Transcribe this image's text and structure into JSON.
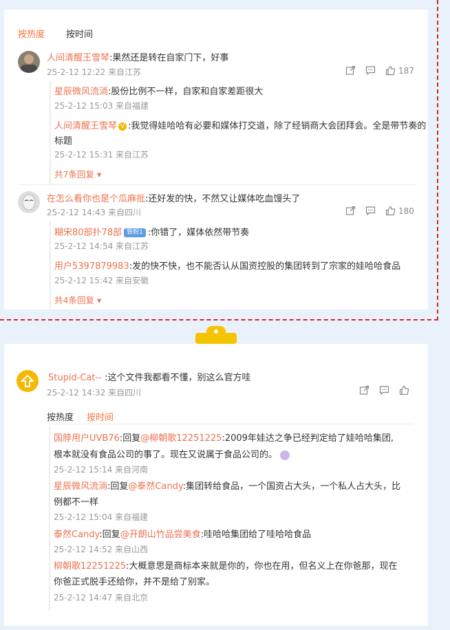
{
  "top": {
    "sort_hot": "按热度",
    "sort_time": "按时间",
    "c1": {
      "user": "人间清醒王雪琴",
      "text": ":果然还是转在自家门下，好事",
      "meta": "25-2-12 12:22 来自江苏",
      "likes": "187",
      "replies": [
        {
          "user": "星辰微风流淌",
          "text": ":股份比例不一样，自家和自家差距很大",
          "meta": "25-2-12 15:03 来自福建"
        },
        {
          "user": "人间清醒王雪琴",
          "text": ":我觉得娃哈哈有必要和媒体打交道，除了经销商大会团拜会。全是带节奏的",
          "text2": "标题",
          "meta": "25-2-12 15:31 来自江苏"
        }
      ],
      "more": "共7条回复"
    },
    "c2": {
      "user": "在怎么看你也是个瓜麻批",
      "text": ":还好发的快，不然又让媒体吃血馒头了",
      "meta": "25-2-12 14:43 来自四川",
      "likes": "180",
      "replies": [
        {
          "user": "糊宋80部扑78部",
          "badge": "铁粉1",
          "text": ":你错了，媒体依然带节奏",
          "meta": "25-2-12 14:54 来自江苏"
        },
        {
          "user": "用户5397879983",
          "text": ":发的快不快，也不能否认从国资控股的集团转到了宗家的娃哈哈食品",
          "meta": "25-2-12 15:42 来自安徽"
        }
      ],
      "more": "共4条回复"
    }
  },
  "bottom": {
    "user": "Stupid-Cat--",
    "text": ":这个文件我都看不懂，别这么官方哇",
    "meta": "25-2-12 14:32 来自四川",
    "sort_hot": "按热度",
    "sort_time": "按时间",
    "replies": [
      {
        "user": "国脖用户UVB76",
        "text": ":回复",
        "mention": "@柳朝歌12251225",
        "text_b": ":2009年娃达之争已经判定给了娃哈哈集团,",
        "text2": "根本就没有食品公司的事了。现在又说属于食品公司的。",
        "meta": "25-2-12 15:14 来自河南"
      },
      {
        "user": "星辰微风流淌",
        "text": ":回复",
        "mention": "@泰然Candy",
        "text_b": ":集团转给食品，一个国资占大头，一个私人占大头，比",
        "text2": "例都不一样",
        "meta": "25-2-12 15:04 来自福建"
      },
      {
        "user": "泰然Candy",
        "text": ":回复",
        "mention": "@开朗山竹品尝美食",
        "text_b": ":哇哈哈集团给了哇哈哈食品",
        "meta": "25-2-12 14:52 来自山西"
      },
      {
        "user": "柳朝歌12251225",
        "text": ":大概意思是商标本来就是你的，你也在用，但名义上在你爸那，现在",
        "text2": "你爸正式脱手还给你，并不是给了别家。",
        "meta": "25-2-12 14:47 来自北京"
      }
    ]
  },
  "colors": {
    "accent": "#f77234",
    "name": "#eb7350",
    "divider_red": "#d9232a",
    "meta": "#999999"
  },
  "icons": [
    "share-icon",
    "comment-icon",
    "like-icon",
    "verified-badge-icon",
    "chevron-down-icon",
    "paperclip-icon",
    "up-arrow-icon"
  ]
}
